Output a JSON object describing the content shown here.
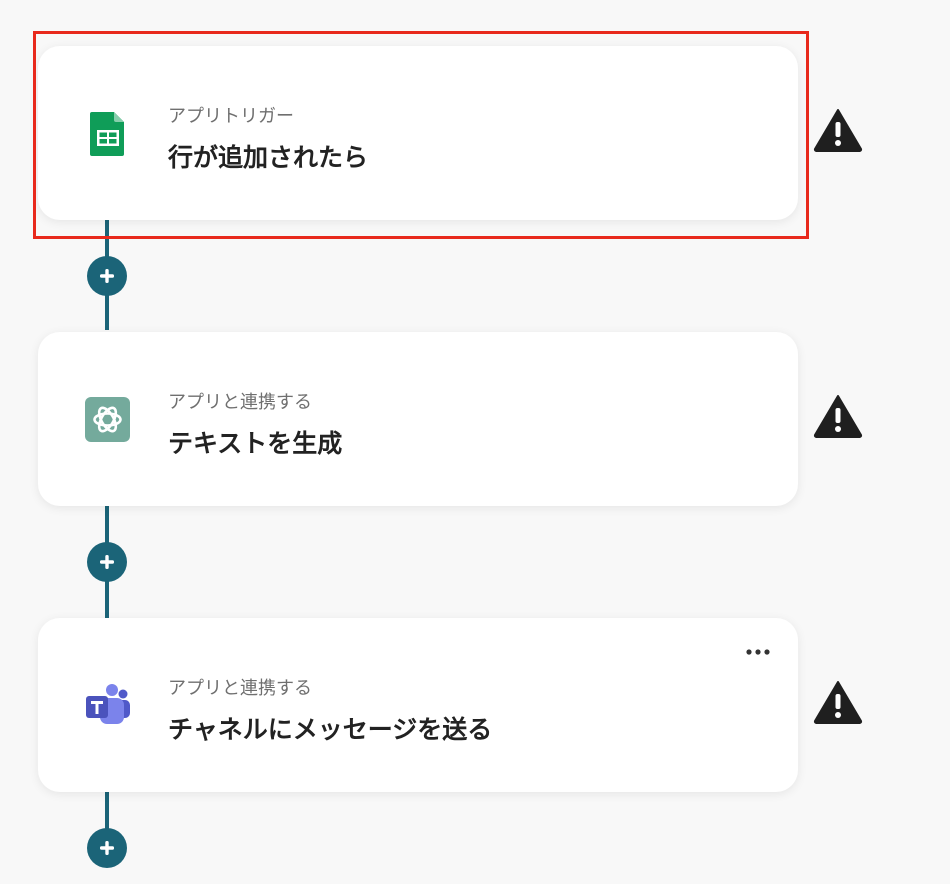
{
  "steps": [
    {
      "subtitle": "アプリトリガー",
      "title": "行が追加されたら",
      "icon": "google-sheets-icon",
      "highlighted": true,
      "warning": true
    },
    {
      "subtitle": "アプリと連携する",
      "title": "テキストを生成",
      "icon": "chatgpt-icon",
      "highlighted": false,
      "warning": true
    },
    {
      "subtitle": "アプリと連携する",
      "title": "チャネルにメッセージを送る",
      "icon": "microsoft-teams-icon",
      "highlighted": false,
      "warning": true,
      "has_more_menu": true
    }
  ],
  "colors": {
    "connector": "#1b6478",
    "highlight_border": "#e8291c",
    "warning": "#1f1f1f",
    "sheets_green": "#0f9d58",
    "chatgpt_bg": "#74aa9c",
    "teams_purple": "#5059c9"
  }
}
